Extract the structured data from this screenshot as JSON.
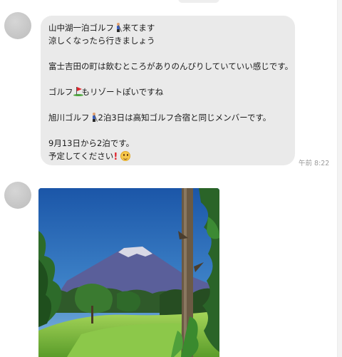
{
  "conversation": {
    "top_pill_text": "",
    "messages": [
      {
        "type": "text",
        "lines": [
          "山中湖一泊ゴルフ",
          "来てます",
          "涼しくなったら行きましょう",
          "",
          "富士吉田の町は飲むところがありのんびりしていていい感じです。",
          "",
          "ゴルフ",
          "もリゾートぽいですね",
          "",
          "旭川ゴルフ",
          "2泊3日は高知ゴルフ合宿と同じメンバーです。",
          "",
          "9月13日から2泊です。",
          "予定してください"
        ],
        "emojis": [
          "golfer-emoji",
          "flag-in-hole-emoji",
          "golfer-emoji",
          "exclamation-emoji",
          "smiling-face-emoji"
        ],
        "timestamp": "午前 8:22"
      },
      {
        "type": "image",
        "image_description_icon": "photo-mount-fuji-golf-course"
      }
    ]
  },
  "colors": {
    "bubble_bg": "#eaeaea",
    "avatar": "#c8c8c8",
    "timestamp": "#9a9a9a",
    "sky": "#1e5fae",
    "grass": "#7cbd3a"
  }
}
